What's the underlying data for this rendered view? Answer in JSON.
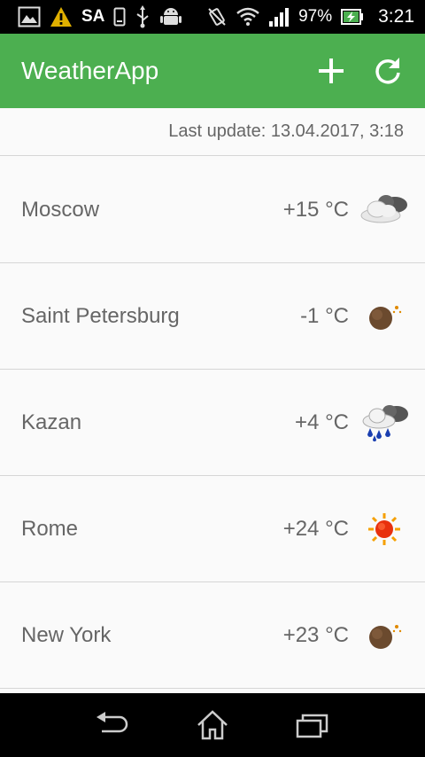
{
  "statusbar": {
    "carrier_text": "SA",
    "battery_percent": "97%",
    "clock": "3:21"
  },
  "appbar": {
    "title": "WeatherApp"
  },
  "last_update": "Last update: 13.04.2017, 3:18",
  "cities": [
    {
      "name": "Moscow",
      "temp": "+15 °C",
      "icon": "cloudy-icon"
    },
    {
      "name": "Saint Petersburg",
      "temp": "-1 °C",
      "icon": "moon-icon"
    },
    {
      "name": "Kazan",
      "temp": "+4 °C",
      "icon": "rain-icon"
    },
    {
      "name": "Rome",
      "temp": "+24 °C",
      "icon": "sun-icon"
    },
    {
      "name": "New York",
      "temp": "+23 °C",
      "icon": "moon-icon"
    }
  ],
  "colors": {
    "appbar": "#4caf50",
    "text": "#666666",
    "divider": "#d6d6d6"
  }
}
